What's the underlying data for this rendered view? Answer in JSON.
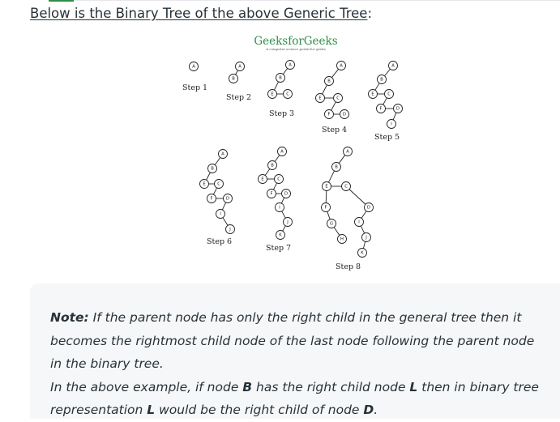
{
  "intro": {
    "prefix": "Below is the Binary Tree of the above Generic Tree",
    "suffix": ":"
  },
  "logo": {
    "brand": "GeeksforGeeks",
    "tagline": "A computer science portal for geeks"
  },
  "steps": [
    {
      "label": "Step 1",
      "nodes": [
        "A"
      ]
    },
    {
      "label": "Step 2",
      "nodes": [
        "A",
        "B"
      ]
    },
    {
      "label": "Step 3",
      "nodes": [
        "A",
        "B",
        "E",
        "C"
      ]
    },
    {
      "label": "Step 4",
      "nodes": [
        "A",
        "B",
        "E",
        "C",
        "F",
        "D"
      ]
    },
    {
      "label": "Step 5",
      "nodes": [
        "A",
        "B",
        "E",
        "C",
        "F",
        "D",
        "I"
      ]
    },
    {
      "label": "Step 6",
      "nodes": [
        "A",
        "B",
        "E",
        "C",
        "F",
        "D",
        "I",
        "J"
      ]
    },
    {
      "label": "Step 7",
      "nodes": [
        "A",
        "B",
        "E",
        "C",
        "F",
        "D",
        "I",
        "J",
        "K"
      ]
    },
    {
      "label": "Step 8",
      "nodes": [
        "A",
        "B",
        "E",
        "C",
        "F",
        "G",
        "H",
        "D",
        "I",
        "J",
        "K"
      ]
    }
  ],
  "note": {
    "label": "Note:",
    "line1": " If the parent node has only the right child in the general tree then it becomes the rightmost child node of the last node following the parent node in the binary tree.",
    "line2_a": "In the above example, if node ",
    "node_b": "B",
    "line2_b": " has the right child node ",
    "node_l1": "L",
    "line2_c": " then in binary tree representation ",
    "node_l2": "L",
    "line2_d": " would be the right child of node ",
    "node_d": "D",
    "line2_e": "."
  }
}
